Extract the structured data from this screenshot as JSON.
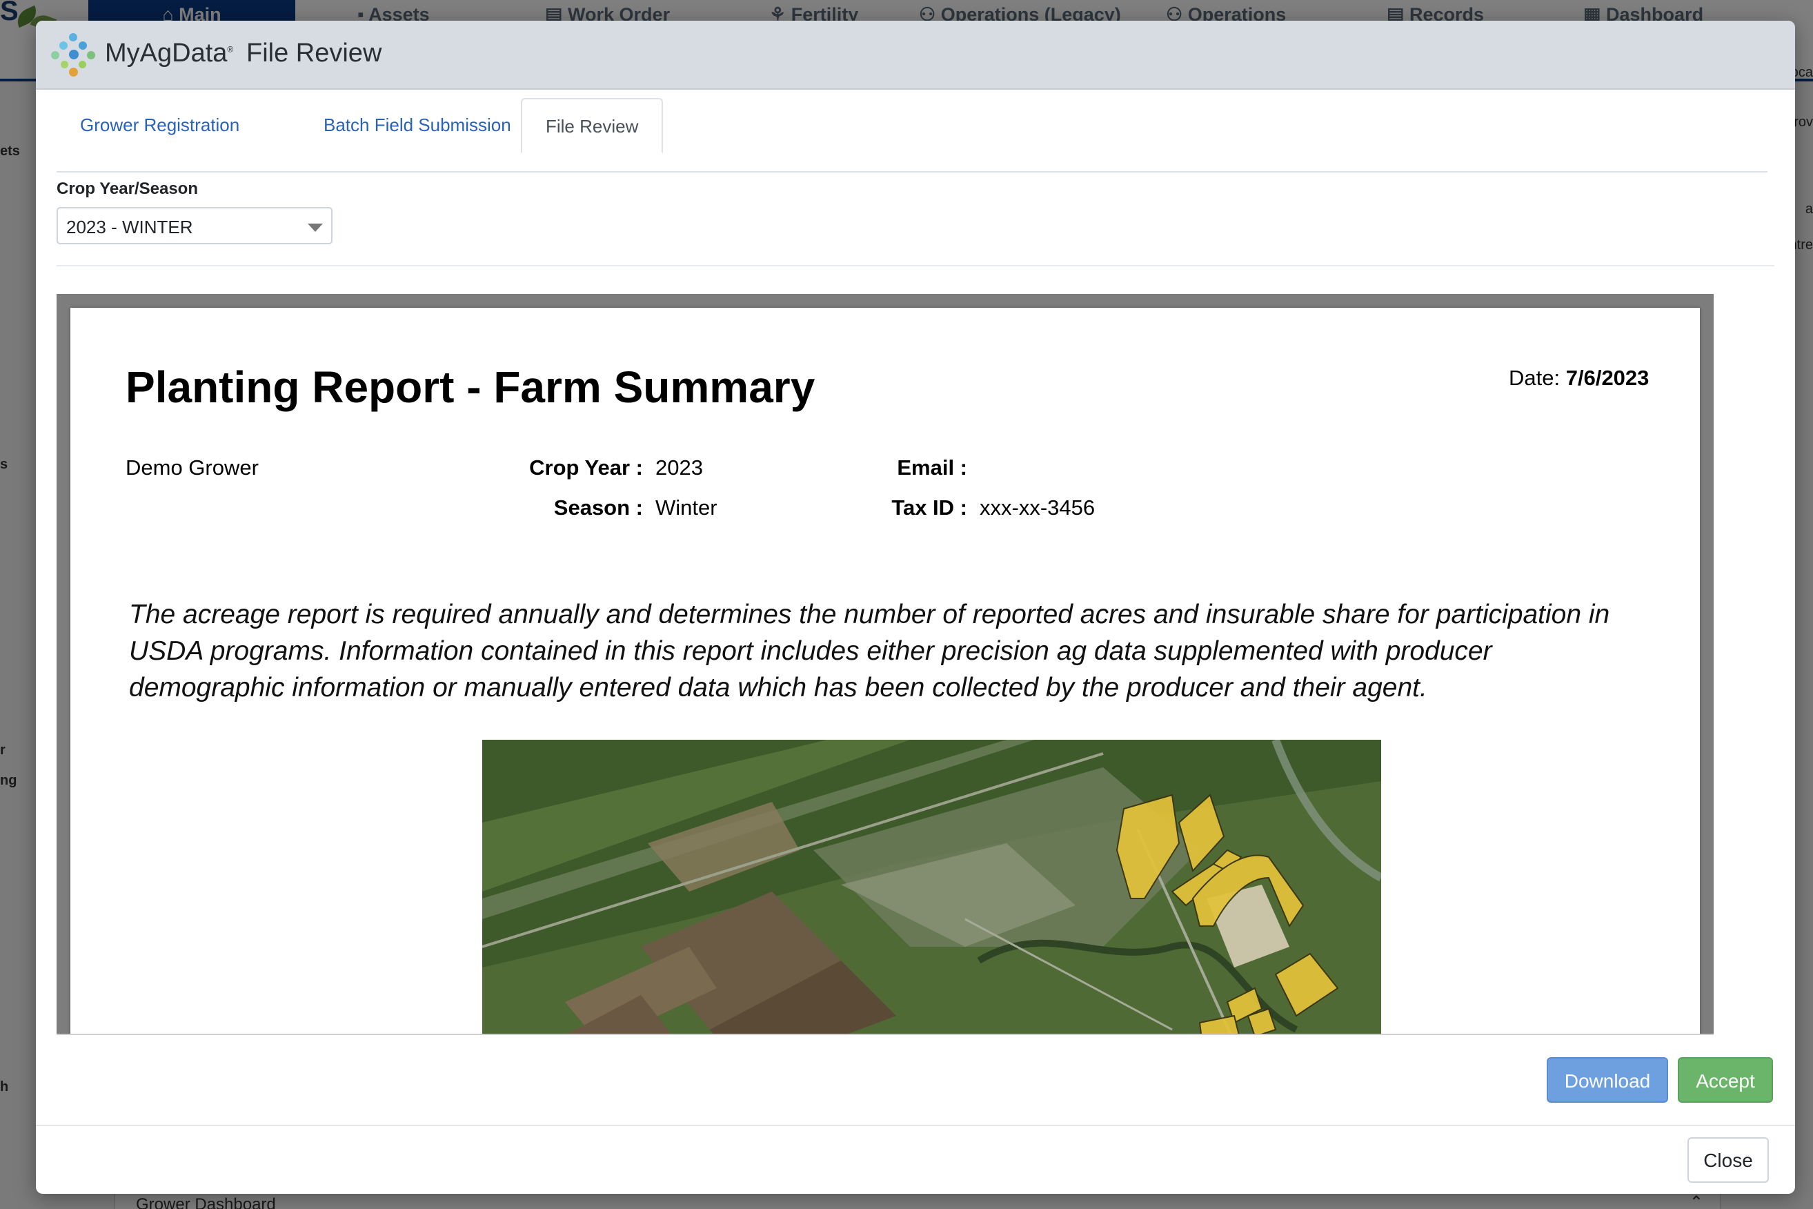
{
  "background": {
    "nav_tabs": [
      {
        "label": "Main",
        "icon": "home-icon"
      },
      {
        "label": "Assets",
        "icon": "tractor-icon"
      },
      {
        "label": "Work Order",
        "icon": "clipboard-icon"
      },
      {
        "label": "Fertility",
        "icon": "sprout-icon"
      },
      {
        "label": "Operations (Legacy)",
        "icon": "people-icon"
      },
      {
        "label": "Operations",
        "icon": "people-icon"
      },
      {
        "label": "Records",
        "icon": "document-icon"
      },
      {
        "label": "Dashboard",
        "icon": "grid-icon"
      }
    ],
    "side_fragments": [
      "ets",
      "s",
      "r",
      "ng",
      "h"
    ],
    "right_fragments": [
      "oca",
      "rov",
      "a",
      "ntre"
    ],
    "bottom_panel": "Grower Dashboard"
  },
  "modal": {
    "brand": "MyAgData",
    "brand_mark": "®",
    "title": "File Review",
    "tabs": [
      {
        "label": "Grower Registration",
        "active": false
      },
      {
        "label": "Batch Field Submission",
        "active": false
      },
      {
        "label": "File Review",
        "active": true
      }
    ],
    "crop_year_label": "Crop Year/Season",
    "crop_year_value": "2023 - WINTER"
  },
  "report": {
    "title": "Planting Report - Farm Summary",
    "date_label": "Date:",
    "date_value": "7/6/2023",
    "grower": "Demo Grower",
    "crop_year_label": "Crop Year :",
    "crop_year": "2023",
    "season_label": "Season :",
    "season": "Winter",
    "email_label": "Email :",
    "email": "",
    "tax_id_label": "Tax ID :",
    "tax_id": "xxx-xx-3456",
    "description": "The acreage report is required annually and determines the number of reported acres and insurable share for participation in USDA programs.  Information contained in this report includes either precision ag data supplemented with producer demographic information or manually entered data which has been collected by the producer and their agent."
  },
  "buttons": {
    "download": "Download",
    "accept": "Accept",
    "close": "Close"
  },
  "colors": {
    "accent_blue": "#0b3a84",
    "link_blue": "#2a62b8",
    "download_blue": "#6e9fdf",
    "accept_green": "#6ab56a",
    "field_yellow": "#e3c23a"
  }
}
